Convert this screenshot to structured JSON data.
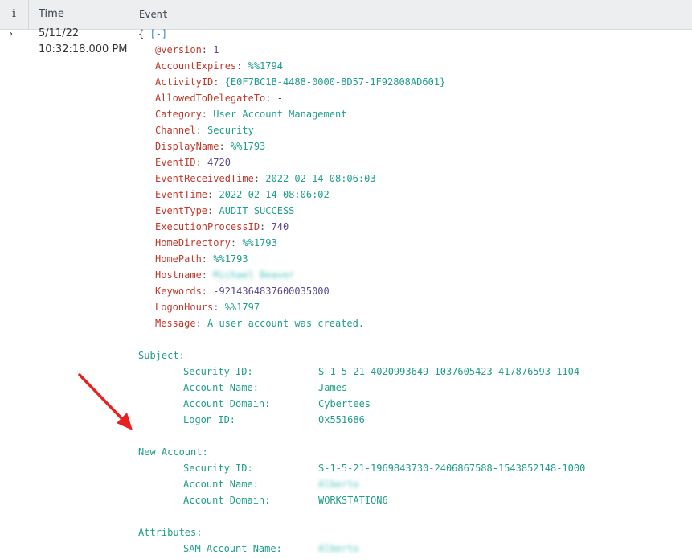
{
  "header": {
    "info_glyph": "i",
    "time_label": "Time",
    "event_label": "Event"
  },
  "row": {
    "expander": "›",
    "date": "5/11/22",
    "time": "10:32:18.000 PM",
    "open_brace": "{",
    "collapse_label": "[-]",
    "fields": [
      {
        "key": "@version",
        "value": "1",
        "type": "num"
      },
      {
        "key": "AccountExpires",
        "value": "%%1794",
        "type": "str"
      },
      {
        "key": "ActivityID",
        "value": "{E0F7BC1B-4488-0000-8D57-1F92808AD601}",
        "type": "str"
      },
      {
        "key": "AllowedToDelegateTo",
        "value": "-",
        "type": "dash"
      },
      {
        "key": "Category",
        "value": "User Account Management",
        "type": "str"
      },
      {
        "key": "Channel",
        "value": "Security",
        "type": "str"
      },
      {
        "key": "DisplayName",
        "value": "%%1793",
        "type": "str"
      },
      {
        "key": "EventID",
        "value": "4720",
        "type": "num"
      },
      {
        "key": "EventReceivedTime",
        "value": "2022-02-14 08:06:03",
        "type": "str"
      },
      {
        "key": "EventTime",
        "value": "2022-02-14 08:06:02",
        "type": "str"
      },
      {
        "key": "EventType",
        "value": "AUDIT_SUCCESS",
        "type": "str"
      },
      {
        "key": "ExecutionProcessID",
        "value": "740",
        "type": "num"
      },
      {
        "key": "HomeDirectory",
        "value": "%%1793",
        "type": "str"
      },
      {
        "key": "HomePath",
        "value": "%%1793",
        "type": "str"
      },
      {
        "key": "Hostname",
        "value": "Michael Beaver",
        "type": "blur"
      },
      {
        "key": "Keywords",
        "value": "-9214364837600035000",
        "type": "num"
      },
      {
        "key": "LogonHours",
        "value": "%%1797",
        "type": "str"
      },
      {
        "key": "Message",
        "value": "A user account was created.",
        "type": "str"
      }
    ],
    "message_sections": [
      {
        "title": "Subject:",
        "rows": [
          {
            "label": "Security ID:",
            "value": "S-1-5-21-4020993649-1037605423-417876593-1104",
            "blur": false
          },
          {
            "label": "Account Name:",
            "value": "James",
            "blur": false
          },
          {
            "label": "Account Domain:",
            "value": "Cybertees",
            "blur": false
          },
          {
            "label": "Logon ID:",
            "value": "0x551686",
            "blur": false
          }
        ]
      },
      {
        "title": "New Account:",
        "rows": [
          {
            "label": "Security ID:",
            "value": "S-1-5-21-1969843730-2406867588-1543852148-1000",
            "blur": false
          },
          {
            "label": "Account Name:",
            "value": "Alberto",
            "blur": true
          },
          {
            "label": "Account Domain:",
            "value": "WORKSTATION6",
            "blur": false
          }
        ]
      },
      {
        "title": "Attributes:",
        "rows": [
          {
            "label": "SAM Account Name:",
            "value": "Alberto",
            "blur": true
          }
        ]
      }
    ]
  },
  "colors": {
    "key": "#c0392b",
    "string": "#1f9e8b",
    "number": "#5b4a8c",
    "link": "#3d83c6",
    "arrow": "#e8201f",
    "header_bg": "#eceef0"
  },
  "annotation": {
    "icon": "red-arrow-icon"
  }
}
